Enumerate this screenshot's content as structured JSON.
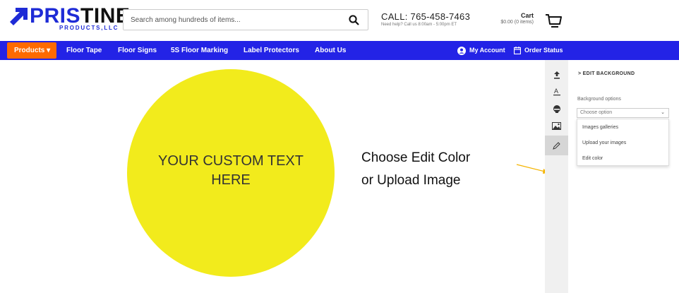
{
  "header": {
    "logo": {
      "brand_first": "PRIS",
      "brand_rest": "TINE",
      "sub": "PRODUCTS,LLC"
    },
    "search": {
      "placeholder": "Search among hundreds of items..."
    },
    "call": {
      "number": "CALL: 765-458-7463",
      "help": "Need help? Call us 8:00am - 5:00pm ET"
    },
    "cart": {
      "title": "Cart",
      "price": "$0.00 (0 items)"
    }
  },
  "nav": {
    "products": "Products",
    "items": [
      "Floor Tape",
      "Floor Signs",
      "5S Floor Marking",
      "Label Protectors",
      "About Us"
    ],
    "account": "My Account",
    "order_status": "Order Status"
  },
  "canvas": {
    "custom_text_line1": "YOUR CUSTOM TEXT",
    "custom_text_line2": "HERE",
    "circle_color": "#f2eb1c"
  },
  "annotation": {
    "line1": "Choose Edit Color",
    "line2": "or Upload Image",
    "arrow_color": "#f5b400"
  },
  "panel": {
    "title": "> EDIT BACKGROUND",
    "label": "Background options",
    "select_value": "Choose option",
    "options": [
      "Images galleries",
      "Upload your images",
      "Edit color"
    ]
  },
  "toolbar_icons": [
    "upload-icon",
    "text-icon",
    "shapes-icon",
    "image-icon",
    "pencil-icon"
  ],
  "colors": {
    "brand_blue": "#2323e6",
    "products_orange": "#ff6a00"
  }
}
